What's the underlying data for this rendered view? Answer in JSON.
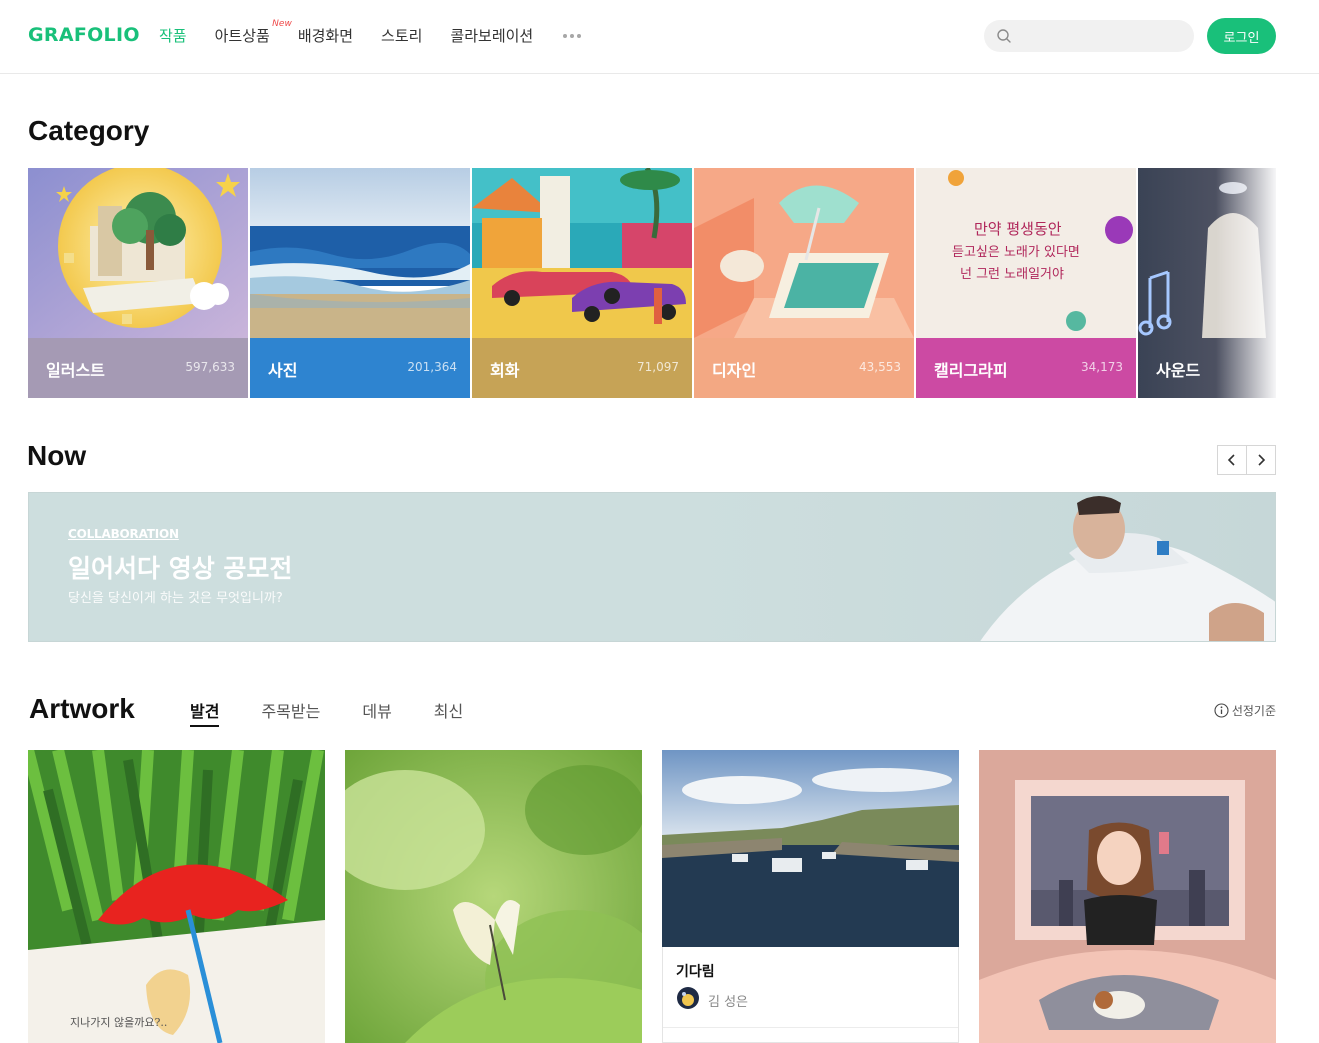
{
  "header": {
    "logo": "GRAFOLIO",
    "nav": [
      {
        "label": "작품",
        "active": true
      },
      {
        "label": "아트상품",
        "badge": "New"
      },
      {
        "label": "배경화면"
      },
      {
        "label": "스토리"
      },
      {
        "label": "콜라보레이션"
      }
    ],
    "more_icon": "more-dots-icon",
    "search": {
      "placeholder": "",
      "icon": "search-icon"
    },
    "login_label": "로그인"
  },
  "category": {
    "heading": "Category",
    "items": [
      {
        "name": "일러스트",
        "count": "597,633",
        "color": "#a59ab4"
      },
      {
        "name": "사진",
        "count": "201,364",
        "color": "#2e84d0"
      },
      {
        "name": "회화",
        "count": "71,097",
        "color": "#c6a356"
      },
      {
        "name": "디자인",
        "count": "43,553",
        "color": "#f3a883"
      },
      {
        "name": "캘리그라피",
        "count": "34,173",
        "color": "#cc4aa3"
      },
      {
        "name": "사운드",
        "count": "",
        "color": "#4b5060"
      }
    ],
    "calligraphy_art_text": [
      "만약 평생동안",
      "듣고싶은 노래가 있다면",
      "넌 그런 노래일거야"
    ]
  },
  "now": {
    "heading": "Now",
    "prev_icon": "chevron-left-icon",
    "next_icon": "chevron-right-icon",
    "banner": {
      "eyebrow": "COLLABORATION",
      "title": "일어서다 영상 공모전",
      "subtitle": "당신을 당신이게 하는 것은 무엇입니까?"
    }
  },
  "artwork": {
    "heading": "Artwork",
    "tabs": [
      {
        "label": "발견",
        "active": true
      },
      {
        "label": "주목받는"
      },
      {
        "label": "데뷰"
      },
      {
        "label": "최신"
      }
    ],
    "criteria_label": "선정기준",
    "criteria_icon": "info-icon",
    "cards": [
      {
        "image": "red-umbrella-illustration",
        "art_text": "지나가지 않을까요?.."
      },
      {
        "image": "butterfly-photo"
      },
      {
        "image": "harbor-photo",
        "title": "기다림",
        "author": "김 성은"
      },
      {
        "image": "girl-selfie-illustration"
      }
    ]
  }
}
